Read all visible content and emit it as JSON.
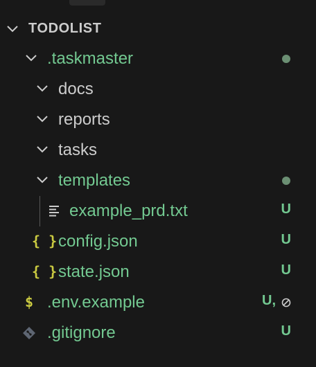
{
  "explorer": {
    "section_title": "TODOLIST",
    "rows": [
      {
        "label": ".taskmaster",
        "status": ""
      },
      {
        "label": "docs"
      },
      {
        "label": "reports"
      },
      {
        "label": "tasks"
      },
      {
        "label": "templates",
        "status": ""
      },
      {
        "label": "example_prd.txt",
        "status": "U"
      },
      {
        "label": "config.json",
        "status": "U",
        "icon": "{ }"
      },
      {
        "label": "state.json",
        "status": "U",
        "icon": "{ }"
      },
      {
        "label": ".env.example",
        "status": "U,",
        "icon": "$"
      },
      {
        "label": ".gitignore",
        "status": "U"
      }
    ]
  },
  "colors": {
    "background": "#181818",
    "untracked_green": "#73c991",
    "json_icon_yellow": "#cbcb41",
    "env_icon_yellow": "#cbcb41",
    "git_icon_grey": "#5e6673",
    "folder_text": "#cccccc",
    "modified_dot": "#6b8f73"
  },
  "icons": {
    "section_chevron": "chevron-down-icon",
    "folder_chevron": "chevron-down-icon",
    "text_file": "text-file-icon",
    "json_file": "json-braces-icon",
    "env_file": "dollar-icon",
    "git_file": "git-diamond-icon",
    "ignored": "circle-slash-icon"
  }
}
